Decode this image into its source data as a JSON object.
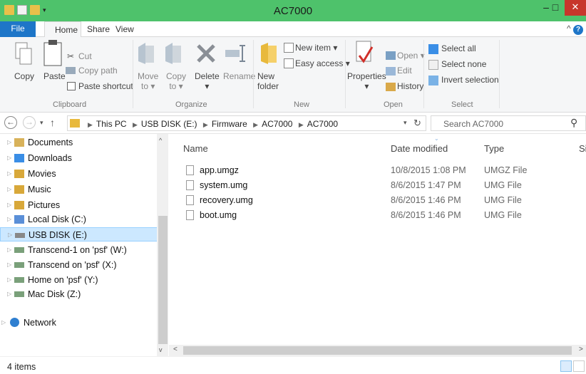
{
  "window": {
    "title": "AC7000",
    "minimize_glyph": "–",
    "maximize_glyph": "□",
    "close_glyph": "✕",
    "accent": "#4ec26b"
  },
  "ribbon_tabs": {
    "file": "File",
    "home": "Home",
    "share": "Share",
    "view": "View"
  },
  "ribbon": {
    "clipboard": {
      "copy": "Copy",
      "paste": "Paste",
      "cut": "Cut",
      "copy_path": "Copy path",
      "paste_shortcut": "Paste shortcut",
      "label": "Clipboard"
    },
    "organize": {
      "move": "Move",
      "move_to": "to ▾",
      "copy": "Copy",
      "copy_to": "to ▾",
      "delete": "Delete",
      "delete_arrow": "▾",
      "rename": "Rename",
      "label": "Organize"
    },
    "new": {
      "new": "New",
      "folder": "folder",
      "new_item": "New item ▾",
      "easy_access": "Easy access ▾",
      "label": "New"
    },
    "open": {
      "properties": "Properties",
      "properties_arrow": "▾",
      "open": "Open ▾",
      "edit": "Edit",
      "history": "History",
      "label": "Open"
    },
    "select": {
      "select_all": "Select all",
      "select_none": "Select none",
      "invert_selection": "Invert selection",
      "label": "Select"
    }
  },
  "address": {
    "back": "←",
    "forward": "→",
    "recent": "▾",
    "up": "↑",
    "breadcrumbs": [
      "This PC",
      "USB DISK (E:)",
      "Firmware",
      "AC7000",
      "AC7000"
    ],
    "dropdown": "▾",
    "refresh": "↻",
    "search_placeholder": "Search AC7000",
    "search_glyph": "⚲"
  },
  "nav": {
    "items": [
      {
        "label": "Documents",
        "icon": "documents-icon",
        "color": "#d8b25a"
      },
      {
        "label": "Downloads",
        "icon": "downloads-icon",
        "color": "#3a8ee6"
      },
      {
        "label": "Movies",
        "icon": "movies-icon",
        "color": "#d8a83a"
      },
      {
        "label": "Music",
        "icon": "music-icon",
        "color": "#d8a83a"
      },
      {
        "label": "Pictures",
        "icon": "pictures-icon",
        "color": "#d8a83a"
      },
      {
        "label": "Local Disk (C:)",
        "icon": "local-disk-icon",
        "color": "#5a8fd8"
      },
      {
        "label": "USB DISK (E:)",
        "icon": "usb-drive-icon",
        "color": "#888888"
      },
      {
        "label": "Transcend-1 on 'psf' (W:)",
        "icon": "network-drive-icon",
        "color": "#7aa07a"
      },
      {
        "label": "Transcend on 'psf' (X:)",
        "icon": "network-drive-icon",
        "color": "#7aa07a"
      },
      {
        "label": "Home on 'psf' (Y:)",
        "icon": "network-drive-icon",
        "color": "#7aa07a"
      },
      {
        "label": "Mac Disk (Z:)",
        "icon": "network-drive-icon",
        "color": "#7aa07a"
      },
      {
        "label": "Network",
        "icon": "network-icon",
        "color": "#2f7fd0"
      }
    ],
    "selected": "USB DISK (E:)"
  },
  "columns": {
    "name": "Name",
    "date_modified": "Date modified",
    "type": "Type",
    "size": "Si"
  },
  "files": [
    {
      "name": "app.umgz",
      "date": "10/8/2015 1:08 PM",
      "type": "UMGZ File"
    },
    {
      "name": "system.umg",
      "date": "8/6/2015 1:47 PM",
      "type": "UMG File"
    },
    {
      "name": "recovery.umg",
      "date": "8/6/2015 1:46 PM",
      "type": "UMG File"
    },
    {
      "name": "boot.umg",
      "date": "8/6/2015 1:46 PM",
      "type": "UMG File"
    }
  ],
  "status": {
    "item_count": "4 items"
  }
}
